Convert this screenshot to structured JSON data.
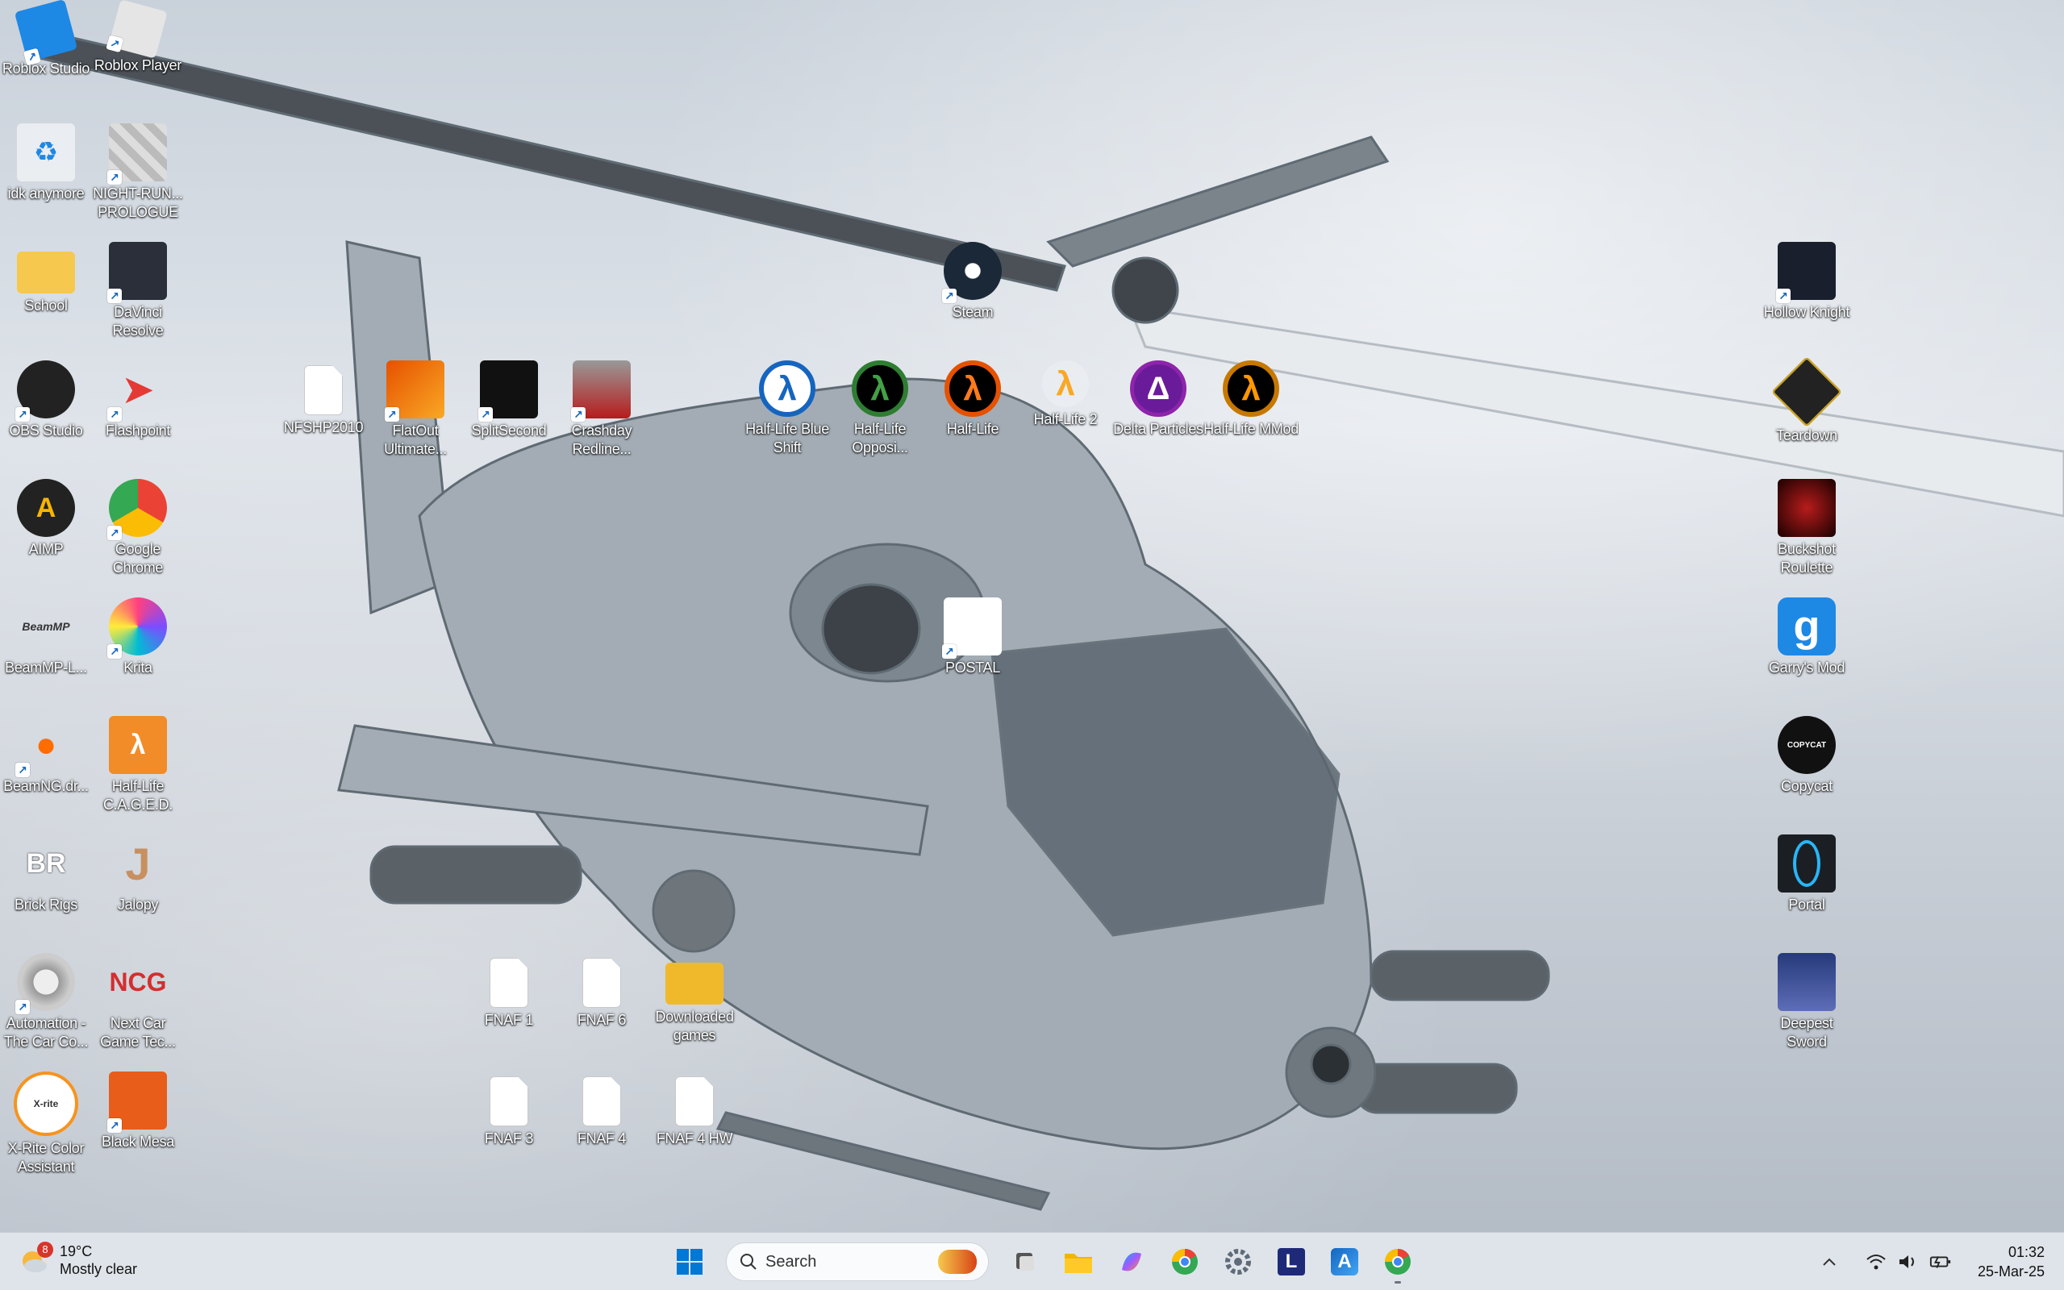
{
  "desktop": {
    "icons": {
      "roblox_studio": "Roblox Studio",
      "roblox_player": "Roblox Player",
      "idk_anymore": "idk anymore",
      "night_run": "NIGHT-RUN... PROLOGUE",
      "school": "School",
      "davinci": "DaVinci Resolve",
      "obs": "OBS Studio",
      "flashpoint": "Flashpoint",
      "aimp": "AIMP",
      "chrome": "Google Chrome",
      "beammp": "BeamMP-L...",
      "krita": "Krita",
      "beamng": "BeamNG.dr...",
      "hl_caged": "Half-Life C.A.G.E.D.",
      "brick_rigs": "Brick Rigs",
      "jalopy": "Jalopy",
      "automation": "Automation - The Car Co...",
      "ncg": "Next Car Game Tec...",
      "xrite": "X-Rite Color Assistant",
      "black_mesa": "Black Mesa",
      "nfshp": "NFSHP2010",
      "flatout": "FlatOut Ultimate...",
      "splitsecond": "SplitSecond",
      "crashday": "Crashday Redline...",
      "steam": "Steam",
      "hl_blue_shift": "Half-Life Blue Shift",
      "hl_opposing": "Half-Life Opposi...",
      "half_life": "Half-Life",
      "half_life_2": "Half-Life 2",
      "delta_particles": "Delta Particles",
      "hl_mmod": "Half-Life MMod",
      "postal": "POSTAL",
      "fnaf1": "FNAF 1",
      "fnaf6": "FNAF 6",
      "downloaded_games": "Downloaded games",
      "fnaf3": "FNAF 3",
      "fnaf4": "FNAF 4",
      "fnaf4hw": "FNAF 4 HW",
      "hollow_knight": "Hollow Knight",
      "teardown": "Teardown",
      "buckshot": "Buckshot Roulette",
      "gmod": "Garry's Mod",
      "copycat": "Copycat",
      "portal": "Portal",
      "deepest_sword": "Deepest Sword"
    },
    "glyphs": {
      "recycle": "♻",
      "lambda": "λ",
      "delta": "Δ",
      "shortcut_arrow": "↗",
      "g": "g",
      "j": "J",
      "ncg": "NCG",
      "br": "BR",
      "beammp": "BeamMP",
      "copycat": "COPYCAT",
      "xrite": "X-rite",
      "L": "L",
      "A": "A"
    }
  },
  "taskbar": {
    "weather": {
      "temp": "19°C",
      "condition": "Mostly clear",
      "badge": "8"
    },
    "search_placeholder": "Search",
    "clock": {
      "time": "01:32",
      "date": "25-Mar-25"
    },
    "tray_chevron": "^"
  },
  "colors": {
    "accent": "#0067c0",
    "taskbar_bg": "#dfe4ea",
    "sky": "#d3d9e0",
    "helicopter": "#8f9aa3"
  }
}
